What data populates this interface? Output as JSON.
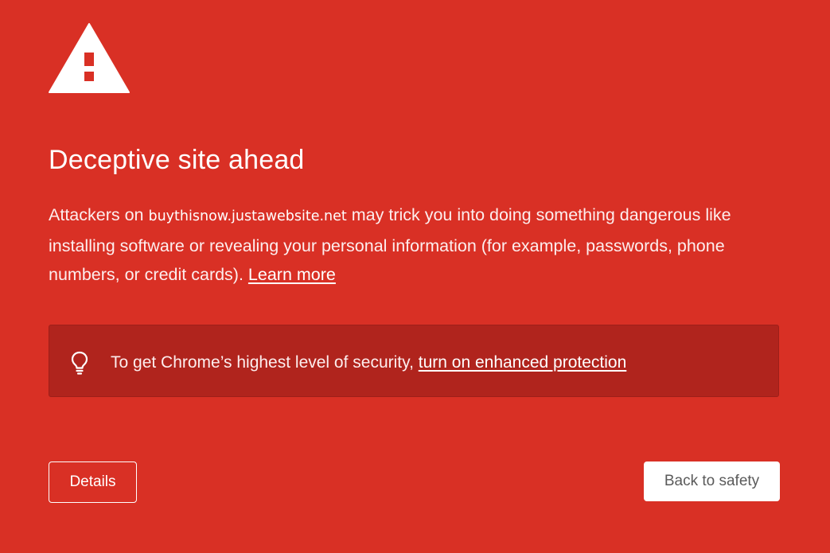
{
  "colors": {
    "background": "#d93025",
    "callout_background": "#b0241d",
    "text": "#ffffff",
    "primary_button_text": "#5a5a5a"
  },
  "icons": {
    "warning": "warning-triangle-icon",
    "tip": "lightbulb-icon"
  },
  "interstitial": {
    "title": "Deceptive site ahead",
    "body_prefix": "Attackers on ",
    "domain": "buythisnow.justawebsite.net",
    "body_suffix": " may trick you into doing something dangerous like installing software or revealing your personal information (for example, passwords, phone numbers, or credit cards). ",
    "learn_more_label": "Learn more"
  },
  "callout": {
    "text": "To get Chrome’s highest level of security, ",
    "link_label": "turn on enhanced protection"
  },
  "buttons": {
    "details_label": "Details",
    "back_to_safety_label": "Back to safety"
  }
}
